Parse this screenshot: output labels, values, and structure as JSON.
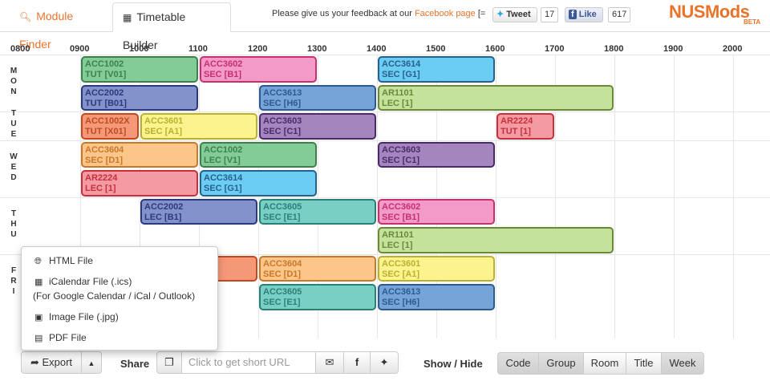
{
  "header": {
    "tabs": [
      {
        "label": "Module Finder",
        "icon": "search-icon"
      },
      {
        "label": "Timetable Builder",
        "icon": "table-icon"
      }
    ],
    "feedback_prefix": "Please give us your feedback at our ",
    "feedback_link": "Facebook page",
    "feedback_suffix": " [=",
    "tweet_label": "Tweet",
    "tweet_count": "17",
    "like_label": "Like",
    "like_count": "617",
    "logo": "NUSMods",
    "logo_badge": "BETA",
    "accent": "#e8742c"
  },
  "timetable": {
    "hours": [
      "0800",
      "0900",
      "1000",
      "1100",
      "1200",
      "1300",
      "1400",
      "1500",
      "1600",
      "1700",
      "1800",
      "1900",
      "2000"
    ],
    "days": [
      {
        "label": "MON",
        "rows": 2
      },
      {
        "label": "TUE",
        "rows": 1
      },
      {
        "label": "WED",
        "rows": 2
      },
      {
        "label": "THU",
        "rows": 2
      },
      {
        "label": "FRI",
        "rows": 2
      }
    ],
    "lessons": [
      {
        "code": "ACC1002",
        "detail": "TUT [V01]",
        "day": 0,
        "row": 0,
        "start": 9,
        "end": 11,
        "bg": "#82cc97",
        "border": "#3f7f4e"
      },
      {
        "code": "ACC3602",
        "detail": "SEC [B1]",
        "day": 0,
        "row": 0,
        "start": 11,
        "end": 13,
        "bg": "#f49ac6",
        "border": "#c43070"
      },
      {
        "code": "ACC3614",
        "detail": "SEC [G1]",
        "day": 0,
        "row": 0,
        "start": 14,
        "end": 16,
        "bg": "#6ccdf4",
        "border": "#27608a"
      },
      {
        "code": "ACC2002",
        "detail": "TUT [B01]",
        "day": 0,
        "row": 1,
        "start": 9,
        "end": 11,
        "bg": "#8492cc",
        "border": "#2b3a7c"
      },
      {
        "code": "ACC3613",
        "detail": "SEC [H6]",
        "day": 0,
        "row": 1,
        "start": 12,
        "end": 14,
        "bg": "#77a4d8",
        "border": "#2c5a90"
      },
      {
        "code": "AR1101",
        "detail": "LEC [1]",
        "day": 0,
        "row": 1,
        "start": 14,
        "end": 18,
        "bg": "#c4e29b",
        "border": "#6a8a38"
      },
      {
        "code": "ACC1002X",
        "detail": "TUT [X01]",
        "day": 1,
        "row": 0,
        "start": 9,
        "end": 10,
        "bg": "#f59878",
        "border": "#c04a20"
      },
      {
        "code": "ACC3601",
        "detail": "SEC [A1]",
        "day": 1,
        "row": 0,
        "start": 10,
        "end": 12,
        "bg": "#fbf48e",
        "border": "#bbb030"
      },
      {
        "code": "ACC3603",
        "detail": "SEC [C1]",
        "day": 1,
        "row": 0,
        "start": 12,
        "end": 14,
        "bg": "#a485bd",
        "border": "#4b2a6c"
      },
      {
        "code": "AR2224",
        "detail": "TUT [1]",
        "day": 1,
        "row": 0,
        "start": 16,
        "end": 17,
        "bg": "#f49aa2",
        "border": "#c4303c"
      },
      {
        "code": "ACC3604",
        "detail": "SEC [D1]",
        "day": 2,
        "row": 0,
        "start": 9,
        "end": 11,
        "bg": "#fcc58a",
        "border": "#c8782a"
      },
      {
        "code": "ACC1002",
        "detail": "LEC [V1]",
        "day": 2,
        "row": 0,
        "start": 11,
        "end": 13,
        "bg": "#82cc97",
        "border": "#3f7f4e"
      },
      {
        "code": "ACC3603",
        "detail": "SEC [C1]",
        "day": 2,
        "row": 0,
        "start": 14,
        "end": 16,
        "bg": "#a485bd",
        "border": "#4b2a6c"
      },
      {
        "code": "AR2224",
        "detail": "LEC [1]",
        "day": 2,
        "row": 1,
        "start": 9,
        "end": 11,
        "bg": "#f49aa2",
        "border": "#c4303c"
      },
      {
        "code": "ACC3614",
        "detail": "SEC [G1]",
        "day": 2,
        "row": 1,
        "start": 11,
        "end": 13,
        "bg": "#6ccdf4",
        "border": "#27608a"
      },
      {
        "code": "ACC2002",
        "detail": "LEC [B1]",
        "day": 3,
        "row": 0,
        "start": 10,
        "end": 12,
        "bg": "#8492cc",
        "border": "#2b3a7c"
      },
      {
        "code": "ACC3605",
        "detail": "SEC [E1]",
        "day": 3,
        "row": 0,
        "start": 12,
        "end": 14,
        "bg": "#78d0c4",
        "border": "#2a8078"
      },
      {
        "code": "ACC3602",
        "detail": "SEC [B1]",
        "day": 3,
        "row": 0,
        "start": 14,
        "end": 16,
        "bg": "#f49ac6",
        "border": "#c43070"
      },
      {
        "code": "AR1101",
        "detail": "LEC [1]",
        "day": 3,
        "row": 1,
        "start": 14,
        "end": 18,
        "bg": "#c4e29b",
        "border": "#6a8a38"
      },
      {
        "code": "",
        "detail": "",
        "day": 4,
        "row": 0,
        "start": 9,
        "end": 12,
        "bg": "#f59878",
        "border": "#c04a20"
      },
      {
        "code": "ACC3604",
        "detail": "SEC [D1]",
        "day": 4,
        "row": 0,
        "start": 12,
        "end": 14,
        "bg": "#fcc58a",
        "border": "#c8782a"
      },
      {
        "code": "ACC3601",
        "detail": "SEC [A1]",
        "day": 4,
        "row": 0,
        "start": 14,
        "end": 16,
        "bg": "#fbf48e",
        "border": "#bbb030"
      },
      {
        "code": "ACC3605",
        "detail": "SEC [E1]",
        "day": 4,
        "row": 1,
        "start": 12,
        "end": 14,
        "bg": "#78d0c4",
        "border": "#2a8078"
      },
      {
        "code": "ACC3613",
        "detail": "SEC [H6]",
        "day": 4,
        "row": 1,
        "start": 14,
        "end": 16,
        "bg": "#77a4d8",
        "border": "#2c5a90"
      }
    ]
  },
  "export_menu": {
    "items": [
      {
        "label": "HTML File",
        "icon": "globe-icon"
      },
      {
        "label": "iCalendar File (.ics)",
        "icon": "calendar-icon"
      },
      {
        "label": "(For Google Calendar / iCal / Outlook)",
        "icon": ""
      },
      {
        "label": "Image File (.jpg)",
        "icon": "image-icon"
      },
      {
        "label": "PDF File",
        "icon": "file-icon"
      }
    ]
  },
  "toolbar": {
    "export_label": "Export",
    "share_label": "Share",
    "url_placeholder": "Click to get short URL",
    "show_hide_label": "Show / Hide",
    "toggles": [
      {
        "label": "Code",
        "active": true
      },
      {
        "label": "Group",
        "active": true
      },
      {
        "label": "Room",
        "active": false
      },
      {
        "label": "Title",
        "active": false
      },
      {
        "label": "Week",
        "active": true
      }
    ]
  }
}
